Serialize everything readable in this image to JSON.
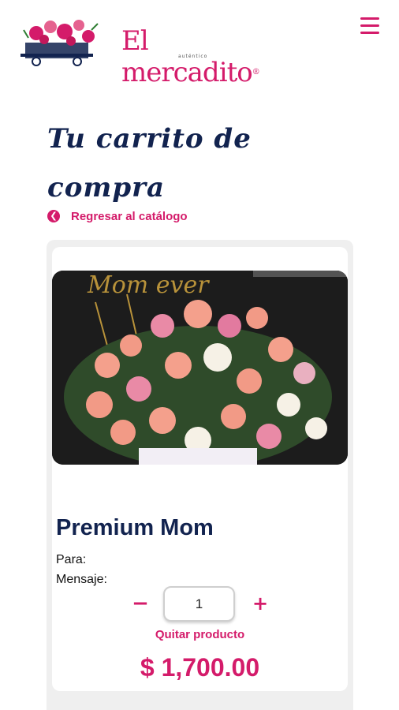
{
  "header": {
    "logo_text": "El mercadito",
    "logo_reg": "®",
    "logo_sub": "auténtico"
  },
  "page": {
    "title_line1": "Tu carrito de",
    "title_line2": "compra",
    "back_label": "Regresar al catálogo"
  },
  "cart": {
    "items": [
      {
        "name": "Premium Mom",
        "image_caption": "Mom ever",
        "para_label": "Para:",
        "mensaje_label": "Mensaje:",
        "quantity": "1",
        "remove_label": "Quitar producto",
        "price": "$ 1,700.00"
      }
    ]
  },
  "colors": {
    "accent": "#d41b6a",
    "navy": "#12234f",
    "panel": "#efefef"
  },
  "icons": {
    "menu": "hamburger-icon",
    "back": "circle-arrow-left-icon",
    "minus": "minus-icon",
    "plus": "plus-icon"
  }
}
